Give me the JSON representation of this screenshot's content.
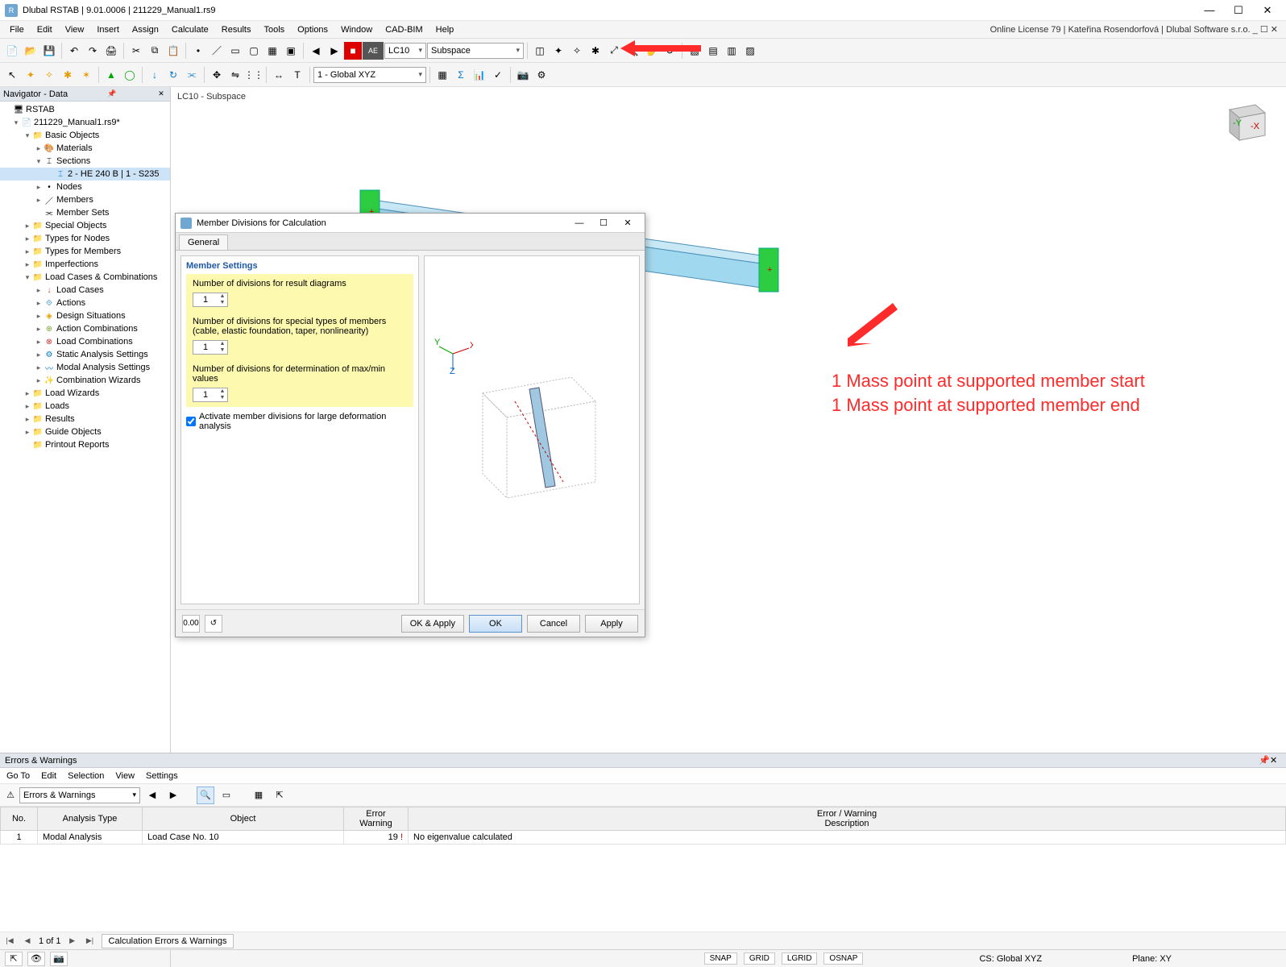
{
  "app": {
    "title": "Dlubal RSTAB | 9.01.0006 | 211229_Manual1.rs9"
  },
  "win": {
    "min": "—",
    "max": "☐",
    "close": "✕"
  },
  "menus": [
    "File",
    "Edit",
    "View",
    "Insert",
    "Assign",
    "Calculate",
    "Results",
    "Tools",
    "Options",
    "Window",
    "CAD-BIM",
    "Help"
  ],
  "license": "Online License 79 | Kateřina Rosendorfová | Dlubal Software s.r.o.   _  ☐  ✕",
  "toolbar2": {
    "ae": "AE",
    "lc_no": "LC10",
    "lc_name": "Subspace"
  },
  "toolbar3": {
    "coord": "1 - Global XYZ"
  },
  "navigator": {
    "title": "Navigator - Data",
    "root": "RSTAB",
    "file": "211229_Manual1.rs9*",
    "basic": "Basic Objects",
    "materials": "Materials",
    "sections": "Sections",
    "section_item": "2 - HE 240 B | 1 - S235",
    "nodes": "Nodes",
    "members": "Members",
    "msets": "Member Sets",
    "special": "Special Objects",
    "tnodes": "Types for Nodes",
    "tmembers": "Types for Members",
    "imperf": "Imperfections",
    "lcases_comb": "Load Cases & Combinations",
    "lcases": "Load Cases",
    "actions": "Actions",
    "dsit": "Design Situations",
    "acomb": "Action Combinations",
    "lcomb": "Load Combinations",
    "sas": "Static Analysis Settings",
    "mas": "Modal Analysis Settings",
    "cwiz": "Combination Wizards",
    "lwiz": "Load Wizards",
    "loads": "Loads",
    "results": "Results",
    "guide": "Guide Objects",
    "printout": "Printout Reports"
  },
  "view": {
    "title": "LC10 - Subspace"
  },
  "annot": {
    "l1": "1 Mass point at supported member start",
    "l2": "1 Mass point at supported member end"
  },
  "dialog": {
    "title": "Member Divisions for Calculation",
    "tab": "General",
    "group": "Member Settings",
    "d1": "Number of divisions for result diagrams",
    "v1": "1",
    "d2": "Number of divisions for special types of members (cable, elastic foundation, taper, nonlinearity)",
    "v2": "1",
    "d3": "Number of divisions for determination of max/min values",
    "v3": "1",
    "chk": "Activate member divisions for large deformation analysis",
    "ok_apply": "OK & Apply",
    "ok": "OK",
    "cancel": "Cancel",
    "apply": "Apply"
  },
  "errors": {
    "title": "Errors & Warnings",
    "menu": [
      "Go To",
      "Edit",
      "Selection",
      "View",
      "Settings"
    ],
    "combo": "Errors & Warnings",
    "cols": {
      "no": "No.",
      "atype": "Analysis Type",
      "obj": "Object",
      "ew": "Error\nWarning",
      "desc": "Error / Warning\nDescription"
    },
    "row": {
      "no": "1",
      "atype": "Modal Analysis",
      "obj": "Load Case No. 10",
      "ew": "19",
      "desc": "No eigenvalue calculated"
    },
    "footer_page": "1 of 1",
    "footer_tab": "Calculation Errors & Warnings"
  },
  "status": {
    "snap": "SNAP",
    "grid": "GRID",
    "lgrid": "LGRID",
    "osnap": "OSNAP",
    "cs": "CS: Global XYZ",
    "plane": "Plane: XY"
  }
}
